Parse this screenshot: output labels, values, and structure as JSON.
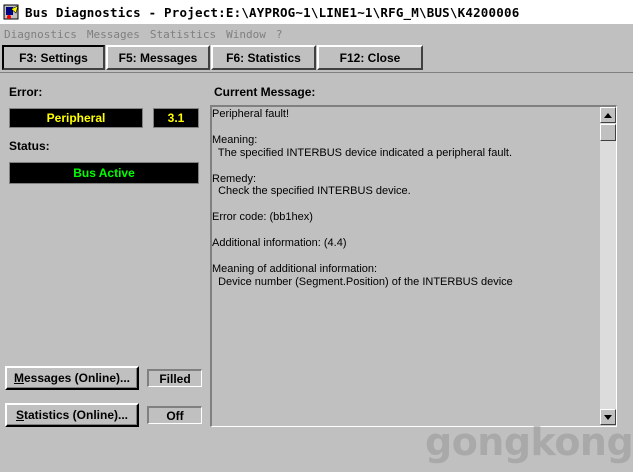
{
  "window": {
    "title": "Bus Diagnostics - Project:E:\\AYPROG~1\\LINE1~1\\RFG_M\\BUS\\K4200006"
  },
  "menu": [
    "Diagnostics",
    "Messages",
    "Statistics",
    "Window",
    "?"
  ],
  "tabs": [
    {
      "label": "F3: Settings",
      "active": true
    },
    {
      "label": "F5: Messages",
      "active": false
    },
    {
      "label": "F6: Statistics",
      "active": false
    },
    {
      "label": "F12: Close",
      "active": false
    }
  ],
  "error": {
    "label": "Error:",
    "value": "Peripheral",
    "code": "3.1",
    "color": "#ffff00"
  },
  "status": {
    "label": "Status:",
    "value": "Bus Active",
    "color": "#00ff00"
  },
  "current_message": {
    "label": "Current Message:",
    "lines": [
      "Peripheral fault!",
      "",
      "Meaning:",
      "  The specified INTERBUS device indicated a peripheral fault.",
      "",
      "Remedy:",
      "  Check the specified INTERBUS device.",
      "",
      "Error code: (bb1hex)",
      "",
      "Additional information: (4.4)",
      "",
      "Meaning of additional information:",
      "  Device number (Segment.Position) of the INTERBUS device"
    ]
  },
  "messages_online": {
    "button_prefix": "M",
    "button_rest": "essages (Online)...",
    "state": "Filled"
  },
  "statistics_online": {
    "button_prefix": "S",
    "button_rest": "tatistics (Online)...",
    "state": "Off"
  },
  "watermark": "gongkong"
}
